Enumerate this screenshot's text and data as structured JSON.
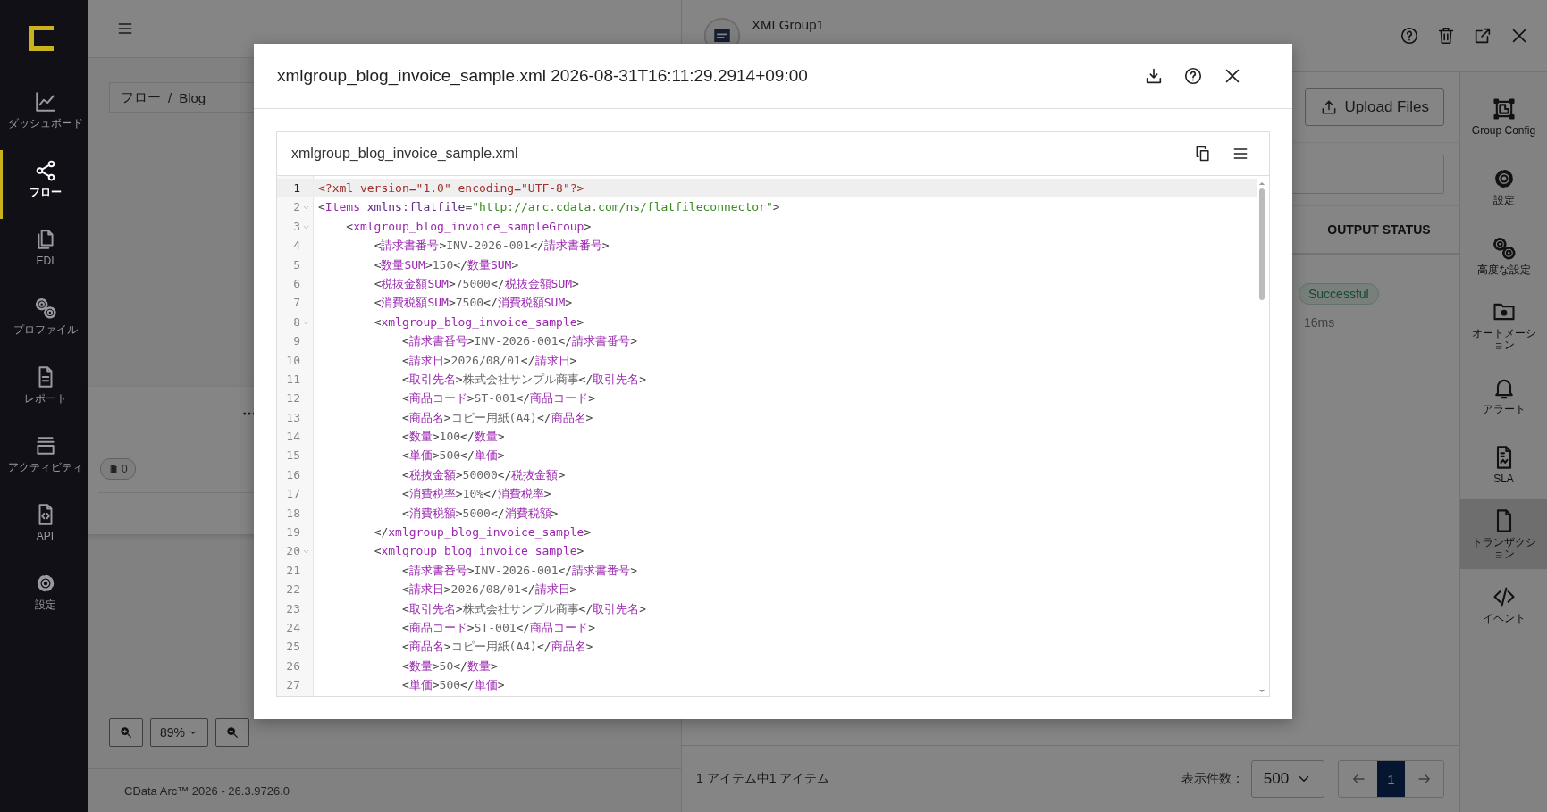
{
  "nav": {
    "items": [
      {
        "label": "ダッシュボード",
        "selected": false
      },
      {
        "label": "フロー",
        "selected": true
      },
      {
        "label": "EDI",
        "selected": false
      },
      {
        "label": "プロファイル",
        "selected": false
      },
      {
        "label": "レポート",
        "selected": false
      },
      {
        "label": "アクティビティ",
        "selected": false
      },
      {
        "label": "API",
        "selected": false
      },
      {
        "label": "設定",
        "selected": false
      }
    ]
  },
  "breadcrumb": {
    "items": [
      "フロー",
      "Blog"
    ],
    "separator": "/"
  },
  "card": {
    "badge": "0"
  },
  "zoom": {
    "value": "89%"
  },
  "footer": "CData Arc™ 2026 - 26.3.9726.0",
  "connector": {
    "name": "XMLGroup1"
  },
  "upload_button": "Upload Files",
  "table": {
    "column": "OUTPUT STATUS",
    "row": {
      "status": "Successful",
      "time": "16ms"
    }
  },
  "pagination": {
    "summary": "1 アイテム中1 アイテム",
    "page_size_label": "表示件数：",
    "page_size": "500",
    "pages": [
      {
        "label": "1",
        "selected": true
      }
    ]
  },
  "side_panel": {
    "items": [
      {
        "label": "Group Config",
        "selected": false
      },
      {
        "label": "設定",
        "selected": false
      },
      {
        "label": "高度な設定",
        "selected": false
      },
      {
        "label": "オートメーション",
        "selected": false
      },
      {
        "label": "アラート",
        "selected": false
      },
      {
        "label": "SLA",
        "selected": false
      },
      {
        "label": "トランザクション",
        "selected": true
      },
      {
        "label": "イベント",
        "selected": false
      }
    ]
  },
  "modal": {
    "title": "xmlgroup_blog_invoice_sample.xml 2026-08-31T16:11:29.2914+09:00",
    "file": {
      "name": "xmlgroup_blog_invoice_sample.xml",
      "lines": [
        {
          "number": "1",
          "text": "<?xml version=\"1.0\" encoding=\"UTF-8\"?>",
          "fold": false,
          "active": true
        },
        {
          "number": "2",
          "text": "<Items xmlns:flatfile=\"http://arc.cdata.com/ns/flatfileconnector\">",
          "fold": true,
          "active": false
        },
        {
          "number": "3",
          "text": "    <xmlgroup_blog_invoice_sampleGroup>",
          "fold": true,
          "active": false
        },
        {
          "number": "4",
          "text": "        <請求書番号>INV-2026-001</請求書番号>",
          "fold": false,
          "active": false
        },
        {
          "number": "5",
          "text": "        <数量SUM>150</数量SUM>",
          "fold": false,
          "active": false
        },
        {
          "number": "6",
          "text": "        <税抜金額SUM>75000</税抜金額SUM>",
          "fold": false,
          "active": false
        },
        {
          "number": "7",
          "text": "        <消費税額SUM>7500</消費税額SUM>",
          "fold": false,
          "active": false
        },
        {
          "number": "8",
          "text": "        <xmlgroup_blog_invoice_sample>",
          "fold": true,
          "active": false
        },
        {
          "number": "9",
          "text": "            <請求書番号>INV-2026-001</請求書番号>",
          "fold": false,
          "active": false
        },
        {
          "number": "10",
          "text": "            <請求日>2026/08/01</請求日>",
          "fold": false,
          "active": false
        },
        {
          "number": "11",
          "text": "            <取引先名>株式会社サンプル商事</取引先名>",
          "fold": false,
          "active": false
        },
        {
          "number": "12",
          "text": "            <商品コード>ST-001</商品コード>",
          "fold": false,
          "active": false
        },
        {
          "number": "13",
          "text": "            <商品名>コピー用紙(A4)</商品名>",
          "fold": false,
          "active": false
        },
        {
          "number": "14",
          "text": "            <数量>100</数量>",
          "fold": false,
          "active": false
        },
        {
          "number": "15",
          "text": "            <単価>500</単価>",
          "fold": false,
          "active": false
        },
        {
          "number": "16",
          "text": "            <税抜金額>50000</税抜金額>",
          "fold": false,
          "active": false
        },
        {
          "number": "17",
          "text": "            <消費税率>10%</消費税率>",
          "fold": false,
          "active": false
        },
        {
          "number": "18",
          "text": "            <消費税額>5000</消費税額>",
          "fold": false,
          "active": false
        },
        {
          "number": "19",
          "text": "        </xmlgroup_blog_invoice_sample>",
          "fold": false,
          "active": false
        },
        {
          "number": "20",
          "text": "        <xmlgroup_blog_invoice_sample>",
          "fold": true,
          "active": false
        },
        {
          "number": "21",
          "text": "            <請求書番号>INV-2026-001</請求書番号>",
          "fold": false,
          "active": false
        },
        {
          "number": "22",
          "text": "            <請求日>2026/08/01</請求日>",
          "fold": false,
          "active": false
        },
        {
          "number": "23",
          "text": "            <取引先名>株式会社サンプル商事</取引先名>",
          "fold": false,
          "active": false
        },
        {
          "number": "24",
          "text": "            <商品コード>ST-001</商品コード>",
          "fold": false,
          "active": false
        },
        {
          "number": "25",
          "text": "            <商品名>コピー用紙(A4)</商品名>",
          "fold": false,
          "active": false
        },
        {
          "number": "26",
          "text": "            <数量>50</数量>",
          "fold": false,
          "active": false
        },
        {
          "number": "27",
          "text": "            <単価>500</単価>",
          "fold": false,
          "active": false
        }
      ]
    }
  }
}
